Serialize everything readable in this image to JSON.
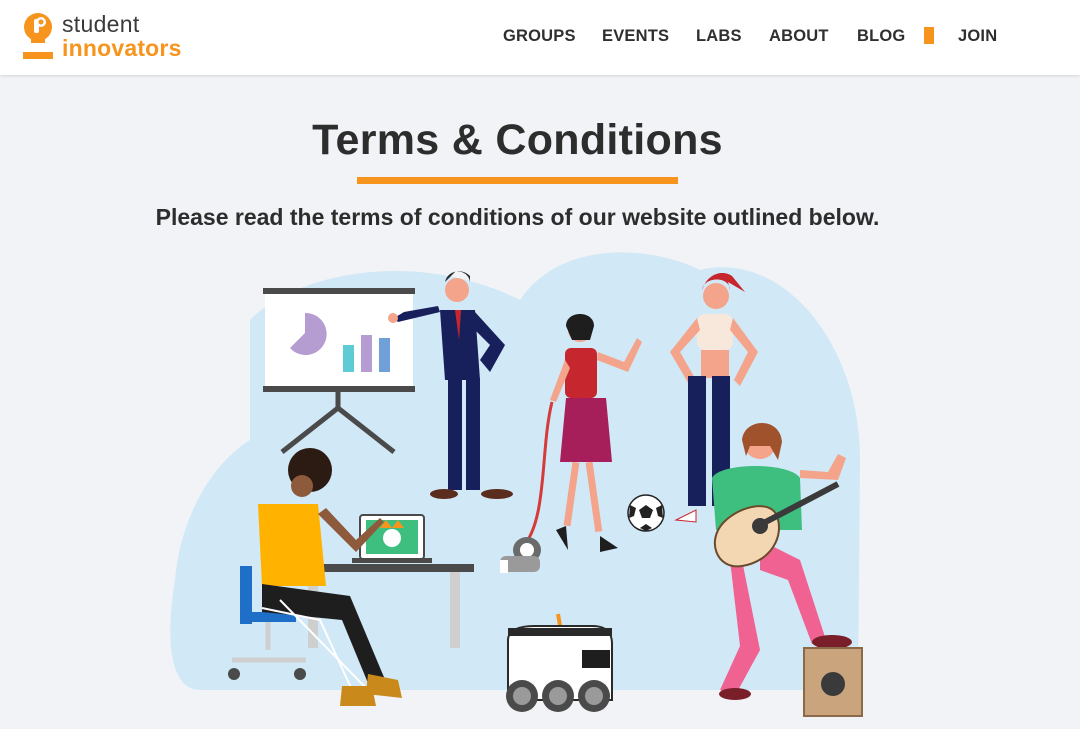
{
  "brand": {
    "name_line1": "student",
    "name_line2": "innovators",
    "accent_color": "#f7941d"
  },
  "nav": {
    "items": [
      {
        "label": "GROUPS"
      },
      {
        "label": "EVENTS"
      },
      {
        "label": "LABS"
      },
      {
        "label": "ABOUT"
      },
      {
        "label": "BLOG"
      },
      {
        "label": "JOIN"
      }
    ]
  },
  "page": {
    "title": "Terms & Conditions",
    "subtitle": "Please read the terms of conditions of our website outlined below."
  },
  "illustration": {
    "chart_icon": "presentation-board-icon",
    "laptop_icon": "laptop-icon",
    "robot_icon": "delivery-robot-icon",
    "ball_icon": "soccer-ball-icon",
    "dog_icon": "dog-icon",
    "guitar_icon": "guitar-icon",
    "speaker_icon": "speaker-box-icon"
  }
}
